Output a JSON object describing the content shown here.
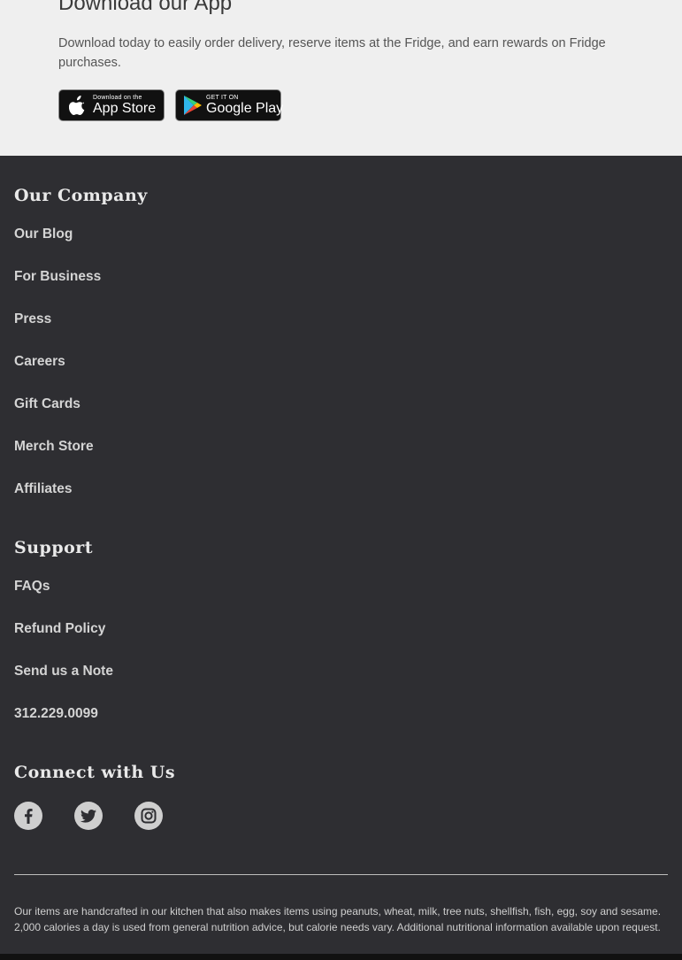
{
  "app": {
    "title": "Download our App",
    "description": "Download today to easily order delivery, reserve items at the Fridge, and earn rewards on Fridge purchases.",
    "app_store": {
      "small": "Download on the",
      "big": "App Store"
    },
    "google_play": {
      "small": "GET IT ON",
      "big": "Google Play"
    }
  },
  "company": {
    "title": "Our Company",
    "links": [
      "Our Blog",
      "For Business",
      "Press",
      "Careers",
      "Gift Cards",
      "Merch Store",
      "Affiliates"
    ]
  },
  "support": {
    "title": "Support",
    "links": [
      "FAQs",
      "Refund Policy",
      "Send us a Note",
      "312.229.0099"
    ]
  },
  "connect": {
    "title": "Connect with Us",
    "icons": [
      "facebook-icon",
      "twitter-icon",
      "instagram-icon"
    ]
  },
  "disclaimer": "Our items are handcrafted in our kitchen that also makes items using peanuts, wheat, milk, tree nuts, shellfish, fish, egg, soy and sesame. 2,000 calories a day is used from general nutrition advice, but calorie needs vary. Additional nutritional information available upon request.",
  "colors": {
    "footer_bg": "#2e2e32",
    "app_bg": "#efefef",
    "link": "#d4d4d4"
  }
}
